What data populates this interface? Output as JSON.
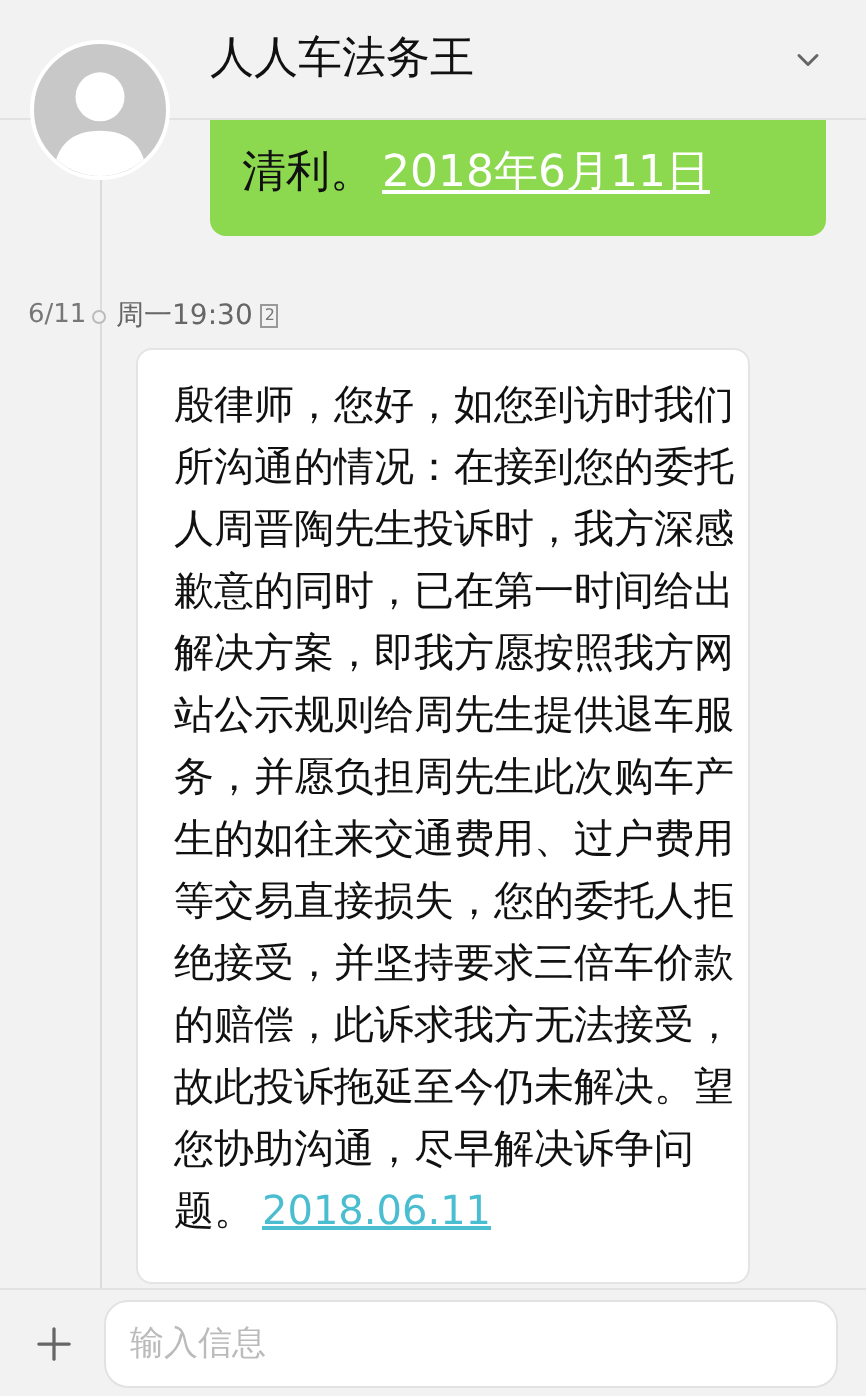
{
  "header": {
    "title": "人人车法务王"
  },
  "messages": [
    {
      "kind": "sent",
      "text": "清利。",
      "link": "2018年6月11日"
    },
    {
      "kind": "received",
      "date": "6/11",
      "time": "周一19:30",
      "sim": "2",
      "text": "殷律师，您好，如您到访时我们所沟通的情况：在接到您的委托人周晋陶先生投诉时，我方深感歉意的同时，已在第一时间给出解决方案，即我方愿按照我方网站公示规则给周先生提供退车服务，并愿负担周先生此次购车产生的如往来交通费用、过户费用等交易直接损失，您的委托人拒绝接受，并坚持要求三倍车价款的赔偿，此诉求我方无法接受，故此投诉拖延至今仍未解决。望您协助沟通，尽早解决诉争问题。",
      "link": "2018.06.11"
    }
  ],
  "composer": {
    "placeholder": "输入信息"
  }
}
